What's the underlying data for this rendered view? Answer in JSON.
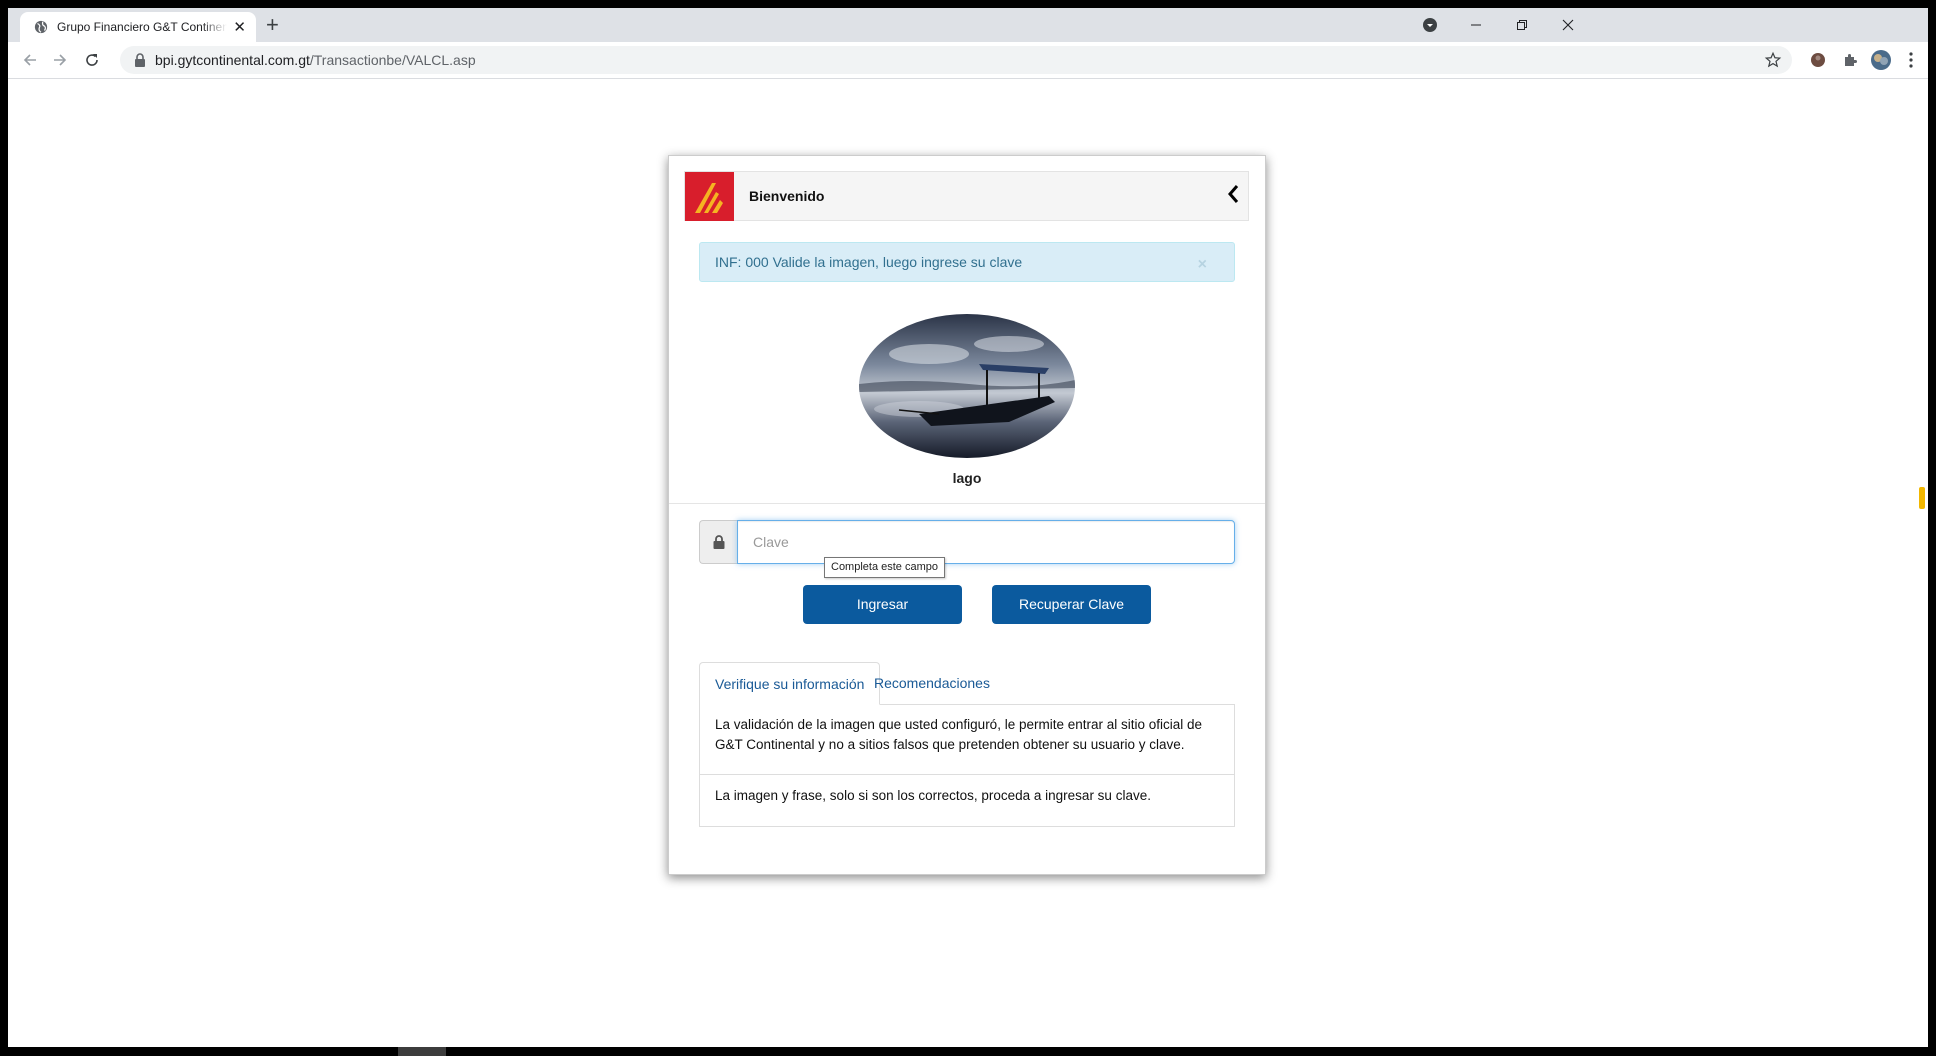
{
  "browser": {
    "tab_title": "Grupo Financiero G&T Continental",
    "url_host": "bpi.gytcontinental.com.gt",
    "url_path": "/Transactionbe/VALCL.asp"
  },
  "header": {
    "title": "Bienvenido"
  },
  "alert": {
    "text": "INF: 000 Valide la imagen, luego ingrese su clave",
    "close": "×"
  },
  "security_image": {
    "caption": "lago"
  },
  "login": {
    "password_placeholder": "Clave",
    "validation_tooltip": "Completa este campo",
    "submit_label": "Ingresar",
    "recover_label": "Recuperar Clave"
  },
  "tabs": [
    {
      "label": "Verifique su información",
      "active": true
    },
    {
      "label": "Recomendaciones",
      "active": false
    }
  ],
  "tab_content": [
    "La validación de la imagen que usted configuró, le permite entrar al sitio oficial de G&T Continental y no a sitios falsos que pretenden obtener su usuario y clave.",
    "La imagen y frase, solo si son los correctos, proceda a ingresar su clave."
  ],
  "colors": {
    "brand_red": "#d81e2c",
    "brand_gold": "#f5b321",
    "primary_button": "#0b5a9e",
    "alert_bg": "#d9edf7",
    "alert_text": "#31708f"
  },
  "icons": [
    "globe-icon",
    "close-icon",
    "plus-icon",
    "profile-menu-icon",
    "minimize-icon",
    "restore-icon",
    "window-close-icon",
    "back-arrow-icon",
    "forward-arrow-icon",
    "reload-icon",
    "lock-icon",
    "star-icon",
    "extension-avatar-icon",
    "puzzle-icon",
    "profile-avatar-icon",
    "kebab-menu-icon",
    "bank-logo",
    "chevron-left-icon",
    "padlock-icon"
  ]
}
